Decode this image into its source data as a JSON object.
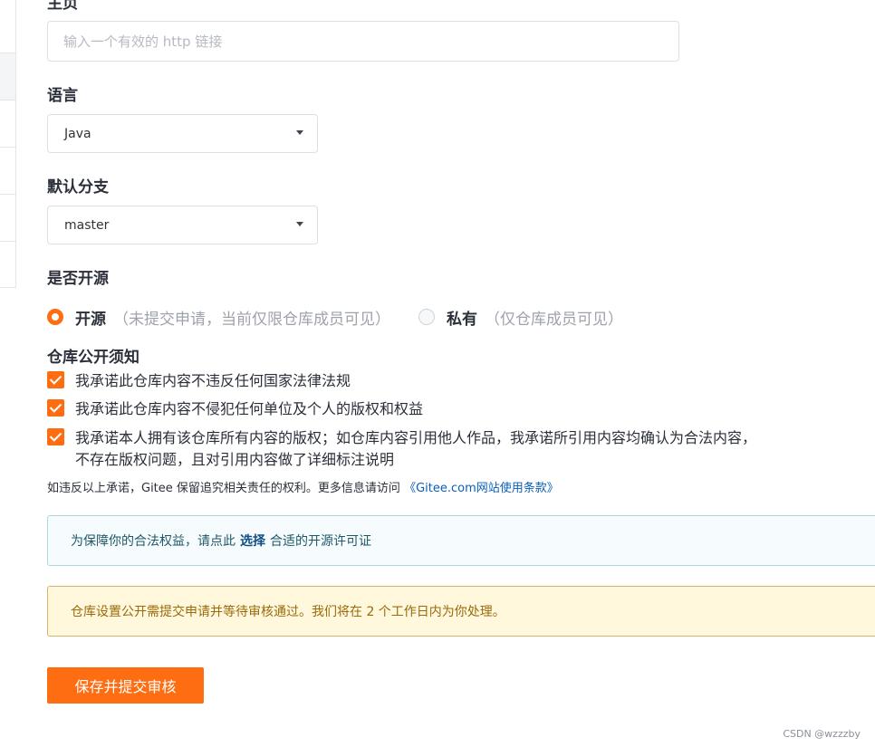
{
  "homepage": {
    "label": "主页",
    "placeholder": "输入一个有效的 http 链接"
  },
  "language": {
    "label": "语言",
    "value": "Java"
  },
  "branch": {
    "label": "默认分支",
    "value": "master"
  },
  "open_source": {
    "label": "是否开源",
    "options": [
      {
        "label": "开源",
        "note": "（未提交申请，当前仅限仓库成员可见）",
        "selected": true
      },
      {
        "label": "私有",
        "note": "（仅仓库成员可见）",
        "selected": false
      }
    ]
  },
  "public_notice": {
    "title": "仓库公开须知",
    "items": [
      {
        "checked": true,
        "line1": "我承诺此仓库内容不违反任何国家法律法规",
        "line2": ""
      },
      {
        "checked": true,
        "line1": "我承诺此仓库内容不侵犯任何单位及个人的版权和权益",
        "line2": ""
      },
      {
        "checked": true,
        "line1": "我承诺本人拥有该仓库所有内容的版权；如仓库内容引用他人作品，我承诺所引用内容均确认为合法内容，",
        "line2": "不存在版权问题，且对引用内容做了详细标注说明"
      }
    ],
    "disclaimer_text": "如违反以上承诺，Gitee 保留追究相关责任的权利。更多信息请访问",
    "disclaimer_link": "《Gitee.com网站使用条款》"
  },
  "license_tip": {
    "before": "为保障你的合法权益，请点此",
    "link": "选择",
    "after": "合适的开源许可证"
  },
  "review_tip": "仓库设置公开需提交申请并等待审核通过。我们将在 2 个工作日内为你处理。",
  "submit_label": "保存并提交审核",
  "watermark": "CSDN @wzzzby",
  "colors": {
    "accent": "#fe6d11",
    "info_border": "#aed8df",
    "warn_border": "#d6b46c"
  }
}
